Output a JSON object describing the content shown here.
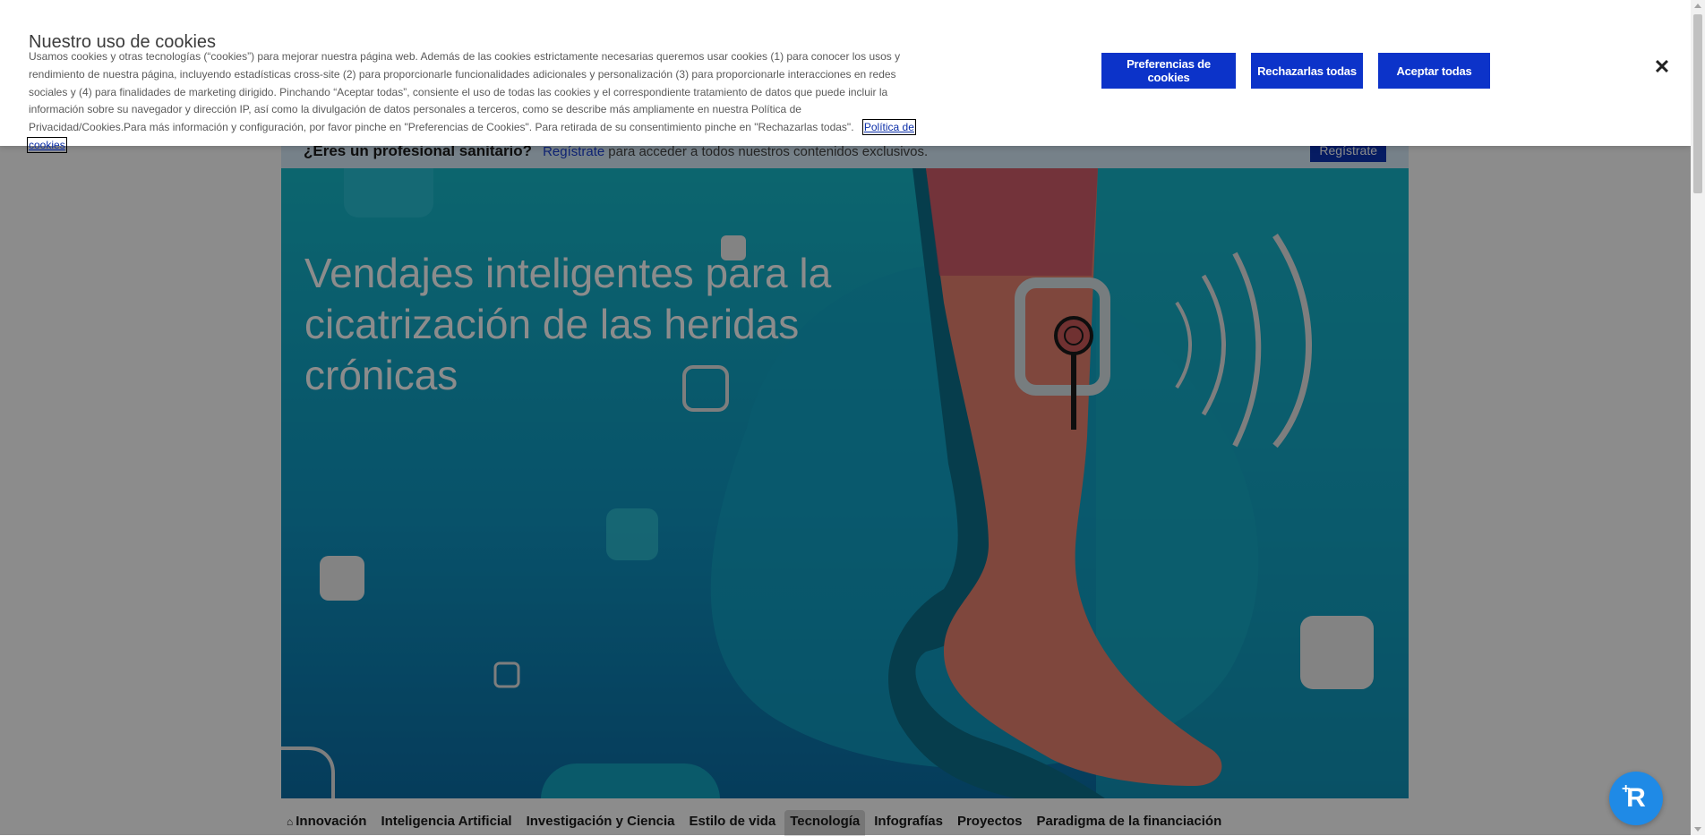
{
  "cookie_banner": {
    "title": "Nuestro uso de cookies",
    "text": "Usamos cookies y otras tecnologías (“cookies”) para mejorar nuestra página web. Además de las cookies estrictamente necesarias queremos usar cookies (1) para conocer los usos y rendimiento de nuestra página, incluyendo estadísticas cross-site (2) para proporcionarle funcionalidades adicionales y personalización (3) para proporcionarle interacciones en redes sociales y (4) para finalidades de marketing dirigido. Pinchando “Aceptar todas”, consiente el uso de todas las cookies y el correspondiente tratamiento de datos que puede incluir la información sobre su navegador y dirección IP, así como la divulgación de datos personales a terceros, como se describe más ampliamente en nuestra Política de Privacidad/Cookies.Para más información y configuración, por favor pinche en \"Preferencias de Cookies\". Para retirada de su consentimiento pinche en \"Rechazarlas todas\".",
    "policy_link": "Política de cookies",
    "btn_preferences": "Preferencias de cookies",
    "btn_reject": "Rechazarlas todas",
    "btn_accept": "Aceptar todas",
    "close_icon": "close-icon",
    "button_color": "#0c33c9"
  },
  "pro_banner": {
    "question": "¿Eres un profesional sanitario?",
    "link": "Regístrate",
    "rest": "para acceder a todos nuestros contenidos exclusivos.",
    "button": "Regístrate"
  },
  "hero": {
    "title": "Vendajes inteligentes para la cicatrización de las heridas crónicas"
  },
  "nav": {
    "items": [
      {
        "label": "Innovación",
        "icon": "home-icon"
      },
      {
        "label": "Inteligencia Artificial"
      },
      {
        "label": "Investigación y Ciencia"
      },
      {
        "label": "Estilo de vida"
      },
      {
        "label": "Tecnología",
        "active": true
      },
      {
        "label": "Infografías"
      },
      {
        "label": "Proyectos"
      },
      {
        "label": "Paradigma de la financiación"
      }
    ]
  },
  "widget": {
    "icon": "assistant-icon"
  }
}
